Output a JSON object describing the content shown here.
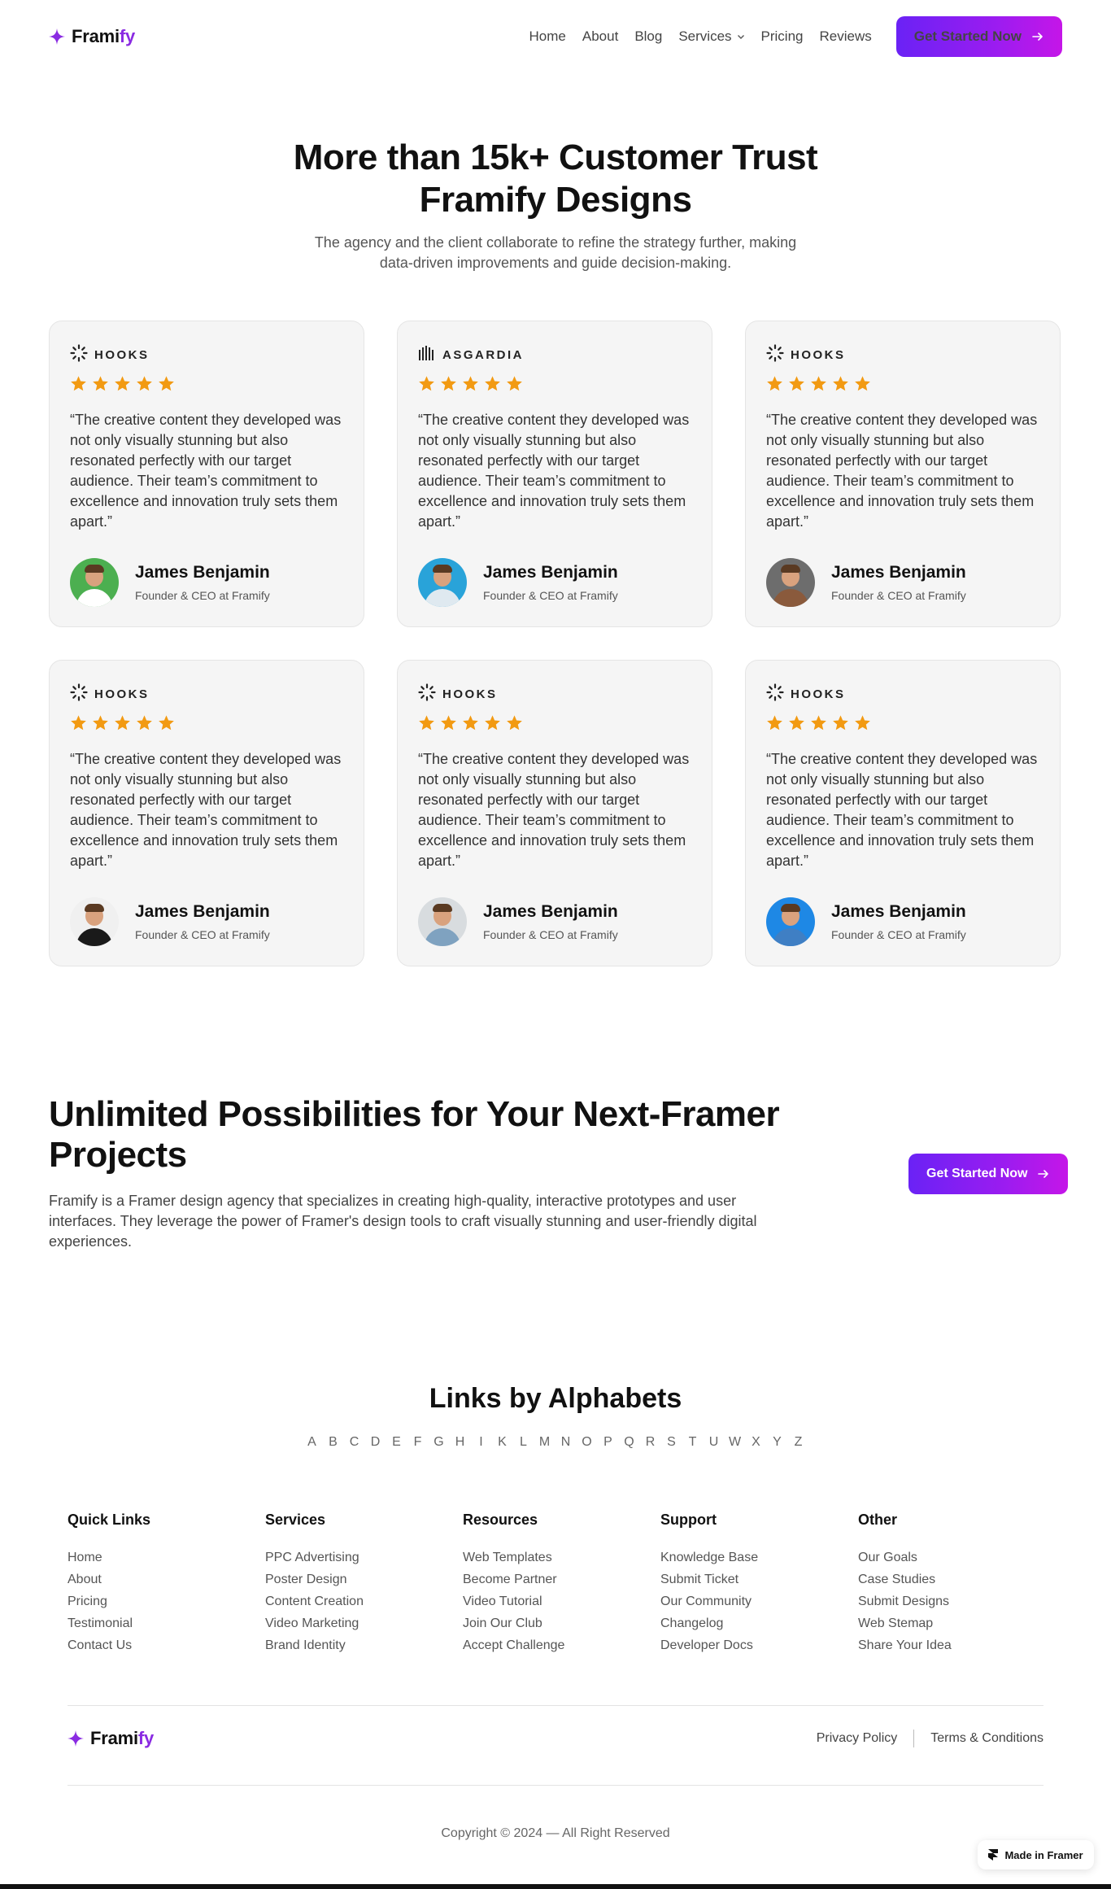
{
  "header": {
    "logo_main": "Frami",
    "logo_accent": "fy",
    "nav": [
      "Home",
      "About",
      "Blog",
      "Services",
      "Pricing",
      "Reviews"
    ],
    "cta_label": "Get Started Now"
  },
  "testimonials": {
    "title_line1": "More than 15k+ Customer Trust",
    "title_line2": "Framify Designs",
    "subtitle_line1": "The agency and the client collaborate to refine the strategy further, making",
    "subtitle_line2": "data-driven improvements and guide decision-making.",
    "rating": "5 of 5",
    "cards": [
      {
        "brand": "HOOKS",
        "quote": "“The creative content they developed was not only visually stunning but also resonated perfectly with our target audience. Their team’s commitment to excellence and innovation truly sets them apart.”",
        "name": "James Benjamin",
        "role": "Founder & CEO at Framify",
        "avatar_bg": "#4caf50",
        "shirt": "#ffffff"
      },
      {
        "brand": "ASGARDIA",
        "quote": "“The creative content they developed was not only visually stunning but also resonated perfectly with our target audience. Their team’s commitment to excellence and innovation truly sets them apart.”",
        "name": "James Benjamin",
        "role": "Founder & CEO at Framify",
        "avatar_bg": "#29a3d9",
        "shirt": "#dfe9f0"
      },
      {
        "brand": "HOOKS",
        "quote": "“The creative content they developed was not only visually stunning but also resonated perfectly with our target audience. Their team’s commitment to excellence and innovation truly sets them apart.”",
        "name": "James Benjamin",
        "role": "Founder & CEO at Framify",
        "avatar_bg": "#6d6d6d",
        "shirt": "#8a5a3c"
      },
      {
        "brand": "HOOKS",
        "quote": "“The creative content they developed was not only visually stunning but also resonated perfectly with our target audience. Their team’s commitment to excellence and innovation truly sets them apart.”",
        "name": "James Benjamin",
        "role": "Founder & CEO at Framify",
        "avatar_bg": "#f0f0f0",
        "shirt": "#1a1a1a"
      },
      {
        "brand": "HOOKS",
        "quote": "“The creative content they developed was not only visually stunning but also resonated perfectly with our target audience. Their team’s commitment to excellence and innovation truly sets them apart.”",
        "name": "James Benjamin",
        "role": "Founder & CEO at Framify",
        "avatar_bg": "#d8dcdf",
        "shirt": "#7fa2c0"
      },
      {
        "brand": "HOOKS",
        "quote": "“The creative content they developed was not only visually stunning but also resonated perfectly with our target audience. Their team’s commitment to excellence and innovation truly sets them apart.”",
        "name": "James Benjamin",
        "role": "Founder & CEO at Framify",
        "avatar_bg": "#1e88e5",
        "shirt": "#3f7fc4"
      }
    ]
  },
  "cta": {
    "title_line1": "Unlimited Possibilities for Your Next-Framer",
    "title_line2": "Projects",
    "text": "Framify is a Framer design agency that specializes in creating high-quality, interactive prototypes and user interfaces. They leverage the power of Framer's design tools to craft visually stunning and user-friendly digital experiences.",
    "button_label": "Get Started Now"
  },
  "links": {
    "title": "Links by Alphabets",
    "letters": [
      "A",
      "B",
      "C",
      "D",
      "E",
      "F",
      "G",
      "H",
      "I",
      "K",
      "L",
      "M",
      "N",
      "O",
      "P",
      "Q",
      "R",
      "S",
      "T",
      "U",
      "W",
      "X",
      "Y",
      "Z"
    ]
  },
  "footer": {
    "columns": [
      {
        "heading": "Quick Links",
        "items": [
          "Home",
          "About",
          "Pricing",
          "Testimonial",
          "Contact Us"
        ]
      },
      {
        "heading": "Services",
        "items": [
          "PPC Advertising",
          "Poster Design",
          "Content Creation",
          "Video Marketing",
          "Brand Identity"
        ]
      },
      {
        "heading": "Resources",
        "items": [
          "Web Templates",
          "Become Partner",
          "Video Tutorial",
          "Join Our Club",
          "Accept Challenge"
        ]
      },
      {
        "heading": "Support",
        "items": [
          "Knowledge Base",
          "Submit Ticket",
          "Our Community",
          "Changelog",
          "Developer Docs"
        ]
      },
      {
        "heading": "Other",
        "items": [
          "Our Goals",
          "Case Studies",
          "Submit Designs",
          "Web Stemap",
          "Share Your Idea"
        ]
      }
    ],
    "privacy": "Privacy Policy",
    "terms": "Terms & Conditions",
    "copyright": "Copyright © 2024 — All Right Reserved",
    "badge": "Made in Framer"
  },
  "colors": {
    "accent": "#8a2be2",
    "star": "#f29a12",
    "card_bg": "#f5f5f5"
  }
}
